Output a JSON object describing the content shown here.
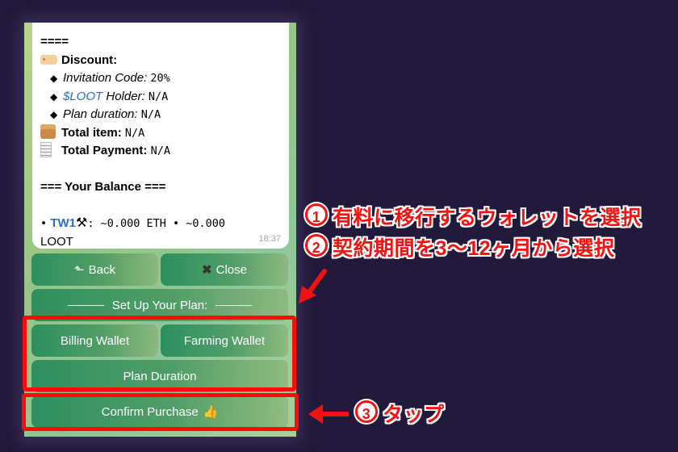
{
  "message": {
    "separator_top": "====",
    "discount_label": "Discount:",
    "discount_items": [
      {
        "label": "Invitation Code:",
        "value": "20%",
        "link_part": ""
      },
      {
        "label": "Holder:",
        "value": "N/A",
        "link_part": "$LOOT"
      },
      {
        "label": "Plan duration:",
        "value": "N/A",
        "link_part": ""
      }
    ],
    "total_item_label": "Total item:",
    "total_item_value": "N/A",
    "total_payment_label": "Total Payment:",
    "total_payment_value": "N/A",
    "balance_header": "=== Your Balance ===",
    "wallet_name": "TW1",
    "wallet_balance_line1": ": ~0.000 ETH • ~0.000",
    "wallet_balance_line2": "LOOT",
    "timestamp": "18:37",
    "icons": {
      "discount": "label-tag-icon",
      "total_item": "package-icon",
      "total_payment": "receipt-icon",
      "wallet": "hammer-and-pick-icon"
    }
  },
  "keyboard": {
    "back_label": "Back",
    "close_label": "Close",
    "section_label": "Set Up Your Plan:",
    "billing_wallet_label": "Billing Wallet",
    "farming_wallet_label": "Farming Wallet",
    "plan_duration_label": "Plan Duration",
    "confirm_label": "Confirm Purchase"
  },
  "annotations": {
    "step1_num": "1",
    "step1_text": "有料に移行するウォレットを選択",
    "step2_num": "2",
    "step2_text": "契約期間を3〜12ヶ月から選択",
    "step3_num": "3",
    "step3_text": "タップ",
    "highlight_color": "#ff0a0a"
  }
}
